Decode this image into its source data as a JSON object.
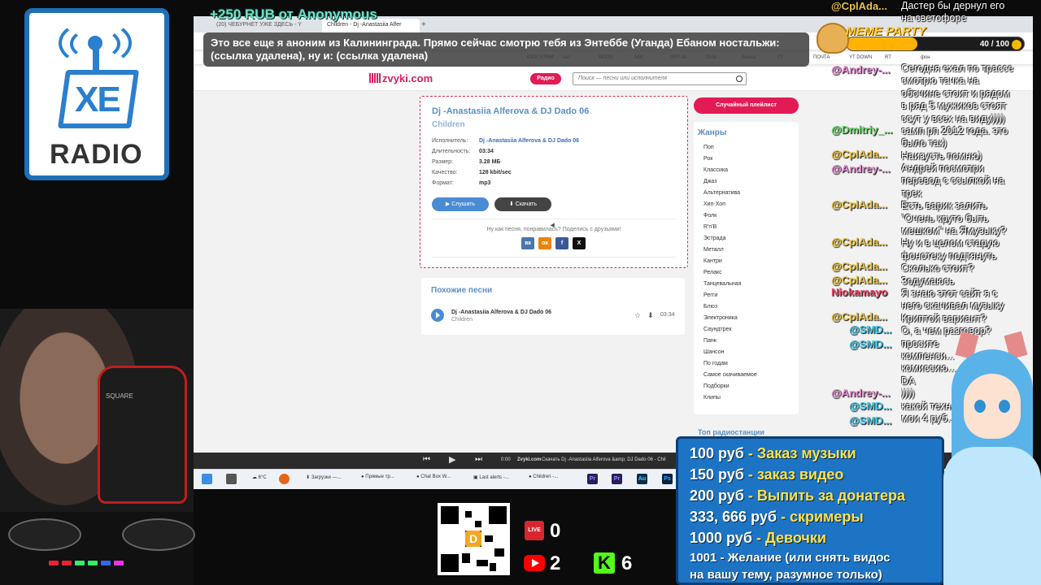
{
  "donation": {
    "text": "+250 RUB  от  Anonymous"
  },
  "alert": {
    "message": "Это все еще я аноним из Калининграда. Прямо сейчас смотрю тебя из Энтеббе (Уганда) Ебаном ностальжи: (ссылка удалена), ну и: (ссылка удалена)"
  },
  "meme_party": {
    "title": "MEME PARTY",
    "count": "40 / 100",
    "progress": 0.4
  },
  "browser": {
    "tabs": [
      {
        "label": "(20) ЧЕБУРНЕТ УЖЕ ЗДЕСЬ - Y"
      },
      {
        "label": "Children - Dj -Anastasiia Alfer"
      }
    ],
    "bookmarks": [
      "KICK STRM",
      "чат",
      "BOOS",
      "MW",
      "GPT 4o",
      "Grok",
      "Алиса",
      "TT",
      "ПОЧТА",
      "YT DOWN",
      "RT",
      "фон"
    ]
  },
  "site": {
    "logo": "zvyki.com",
    "radio_button": "Радио",
    "search_placeholder": "Поиск — песни или исполнителя"
  },
  "track": {
    "title": "Dj -Anastasiia Alferova & DJ Dado 06",
    "subtitle": "Children",
    "labels": {
      "artist": "Исполнитель:",
      "duration": "Длительность:",
      "size": "Размер:",
      "quality": "Качество:",
      "format": "Формат:"
    },
    "values": {
      "artist": "Dj -Anastasiia Alferova & DJ Dado 06",
      "duration": "03:34",
      "size": "3.28 МБ",
      "quality": "128 kbit/sec",
      "format": "mp3"
    },
    "listen_label": "Слушать",
    "download_label": "Скачать",
    "share_text": "Ну как песня, понравилась? Поделись с друзьями!",
    "social": [
      "вк",
      "ок",
      "f",
      "X"
    ]
  },
  "similar": {
    "title": "Похожие песни",
    "items": [
      {
        "name": "Dj -Anastasiia Alferova & DJ Dado 06",
        "sub": "Children",
        "time": "03:34"
      }
    ]
  },
  "sidebar": {
    "random_button": "Случайный плейлист",
    "genres_title": "Жанры",
    "genres": [
      "Поп",
      "Рок",
      "Классика",
      "Джаз",
      "Альтернатива",
      "Хип-Хоп",
      "Фолк",
      "R'n'B",
      "Эстрада",
      "Металл",
      "Кантри",
      "Релакс",
      "Танцевальная",
      "Регги",
      "Блюз",
      "Электроника",
      "Саундтрек",
      "Панк",
      "Шансон",
      "По годам",
      "Самое скачиваемое",
      "Подборки",
      "Клипы"
    ],
    "top_radio": "Топ радиостанции"
  },
  "player": {
    "time": "0:00",
    "site": "Zvyki.com",
    "now": "Скачать Dj -Anastasiia Alferova &amp; DJ Dado 06 - Chil"
  },
  "taskbar": {
    "temp": "6°C",
    "items": [
      "Загрузки —...",
      "Прямые тр...",
      "Chat Box W...",
      "Last alerts -...",
      "Children -..."
    ],
    "apps": [
      "Pr",
      "Pr",
      "Au",
      "Ps"
    ]
  },
  "xe": {
    "xe": "XE",
    "radio": "RADIO"
  },
  "chat": {
    "users": [
      {
        "name": "@CplAda...",
        "color": "#e8c44a"
      },
      {
        "name": "@Andrey-...",
        "color": "#e58ad0"
      },
      {
        "name": "@Dmitriy_...",
        "color": "#6fd96f"
      },
      {
        "name": "@CplAda...",
        "color": "#e8c44a"
      },
      {
        "name": "@Andrey-...",
        "color": "#e58ad0"
      },
      {
        "name": "@CplAda...",
        "color": "#e8c44a"
      },
      {
        "name": "@CplAda...",
        "color": "#e8c44a"
      },
      {
        "name": "@CplAda...",
        "color": "#e8c44a"
      },
      {
        "name": "@CplAda...",
        "color": "#e8c44a"
      },
      {
        "name": "Niokamayo",
        "color": "#e84a6a"
      },
      {
        "name": "@CplAda...",
        "color": "#e8c44a"
      },
      {
        "name": "@SMD...",
        "color": "#4ac9e8"
      },
      {
        "name": "@SMD...",
        "color": "#4ac9e8"
      },
      {
        "name": "@Andrey-...",
        "color": "#e58ad0"
      },
      {
        "name": "@SMD...",
        "color": "#4ac9e8"
      },
      {
        "name": "@SMD...",
        "color": "#4ac9e8"
      }
    ],
    "lines": [
      "Дастер бы дернул его",
      "на светофоре",
      "",
      "",
      "",
      "Сегодня ехал по трассе",
      "смотрю тачка на",
      "обочине стоит и рядом",
      "в ряд 5 мужиков стоят",
      "ссут у всех на виду))))",
      "самп рп 2012 года. это",
      "было так)",
      "Наизусть помню)",
      "Андрей посмотри",
      "перевод с ссылкой на",
      "трек",
      "Есть варик залить",
      "\"Очень круто быть",
      "мешком\" на Ямузыку?",
      "Ну и в целом старую",
      "фонотеку подтянуть",
      "Сколько стоит?",
      "Зодумаюсь",
      "Я знаю этот сайт я с",
      "него скачивал музыку",
      "Криптой вариант?",
      "О, а чем разговор?",
      "просите",
      "компенси...",
      "комиссию...",
      "DA",
      "))))",
      "какой техн...",
      "мои 4 руб..."
    ]
  },
  "stats": {
    "live": "0",
    "youtube": "2",
    "kick": "6"
  },
  "prices": [
    {
      "amount": "100 руб",
      "desc": " - Заказ музыки"
    },
    {
      "amount": "150 руб",
      "desc": " - заказ видео"
    },
    {
      "amount": "200 руб",
      "desc": " - Выпить за донатера"
    },
    {
      "amount": "333, 666 руб",
      "desc": " - скримеры"
    },
    {
      "amount": "1000 руб",
      "desc": " - Девочки"
    },
    {
      "amount": "1001",
      "desc": " - Желание (или снять видос"
    },
    {
      "amount": "",
      "desc": "на вашу тему, разумное только)"
    }
  ],
  "colors": {
    "accent": "#e31b54",
    "link": "#5b8fc7",
    "price_bg": "#1d74c4"
  }
}
